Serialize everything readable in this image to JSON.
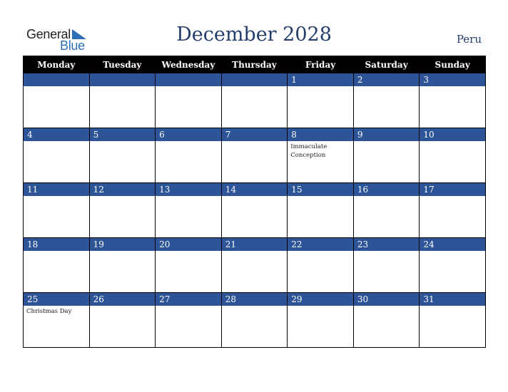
{
  "logo": {
    "word1": "General",
    "word2": "Blue",
    "icon": "triangle-flag-icon"
  },
  "header": {
    "title": "December 2028",
    "country": "Peru"
  },
  "colors": {
    "accent": "#2d5496",
    "header_bg": "#000000",
    "title": "#253d6b",
    "logo_blue": "#2e6fb7"
  },
  "weekdays": [
    "Monday",
    "Tuesday",
    "Wednesday",
    "Thursday",
    "Friday",
    "Saturday",
    "Sunday"
  ],
  "weeks": [
    [
      {
        "day": "",
        "event": ""
      },
      {
        "day": "",
        "event": ""
      },
      {
        "day": "",
        "event": ""
      },
      {
        "day": "",
        "event": ""
      },
      {
        "day": "1",
        "event": ""
      },
      {
        "day": "2",
        "event": ""
      },
      {
        "day": "3",
        "event": ""
      }
    ],
    [
      {
        "day": "4",
        "event": ""
      },
      {
        "day": "5",
        "event": ""
      },
      {
        "day": "6",
        "event": ""
      },
      {
        "day": "7",
        "event": ""
      },
      {
        "day": "8",
        "event": "Immaculate Conception"
      },
      {
        "day": "9",
        "event": ""
      },
      {
        "day": "10",
        "event": ""
      }
    ],
    [
      {
        "day": "11",
        "event": ""
      },
      {
        "day": "12",
        "event": ""
      },
      {
        "day": "13",
        "event": ""
      },
      {
        "day": "14",
        "event": ""
      },
      {
        "day": "15",
        "event": ""
      },
      {
        "day": "16",
        "event": ""
      },
      {
        "day": "17",
        "event": ""
      }
    ],
    [
      {
        "day": "18",
        "event": ""
      },
      {
        "day": "19",
        "event": ""
      },
      {
        "day": "20",
        "event": ""
      },
      {
        "day": "21",
        "event": ""
      },
      {
        "day": "22",
        "event": ""
      },
      {
        "day": "23",
        "event": ""
      },
      {
        "day": "24",
        "event": ""
      }
    ],
    [
      {
        "day": "25",
        "event": "Christmas Day"
      },
      {
        "day": "26",
        "event": ""
      },
      {
        "day": "27",
        "event": ""
      },
      {
        "day": "28",
        "event": ""
      },
      {
        "day": "29",
        "event": ""
      },
      {
        "day": "30",
        "event": ""
      },
      {
        "day": "31",
        "event": ""
      }
    ]
  ]
}
